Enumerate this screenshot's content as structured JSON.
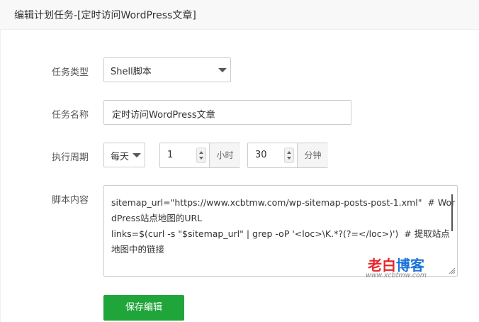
{
  "dialog": {
    "title": "编辑计划任务-[定时访问WordPress文章]"
  },
  "form": {
    "task_type": {
      "label": "任务类型",
      "value": "Shell脚本"
    },
    "task_name": {
      "label": "任务名称",
      "value": "定时访问WordPress文章"
    },
    "period": {
      "label": "执行周期",
      "frequency": "每天",
      "hour_value": "1",
      "hour_unit": "小时",
      "minute_value": "30",
      "minute_unit": "分钟"
    },
    "script": {
      "label": "脚本内容",
      "content": "sitemap_url=\"https://www.xcbtmw.com/wp-sitemap-posts-post-1.xml\"  # WordPress站点地图的URL\nlinks=$(curl -s \"$sitemap_url\" | grep -oP '<loc>\\K.*?(?=</loc>)')  # 提取站点地图中的链接\n\nfor link in $links"
    },
    "save_label": "保存编辑"
  },
  "watermark": {
    "name_part1": "老白",
    "name_part2": "博客",
    "url": "www.xcbtmw.com"
  },
  "colors": {
    "primary_green": "#20a53a",
    "watermark_red": "#e8262b",
    "watermark_blue": "#1a73d9"
  },
  "icons": [
    "chevron-down-icon",
    "spinner-up-icon",
    "spinner-down-icon",
    "resize-handle-icon"
  ]
}
